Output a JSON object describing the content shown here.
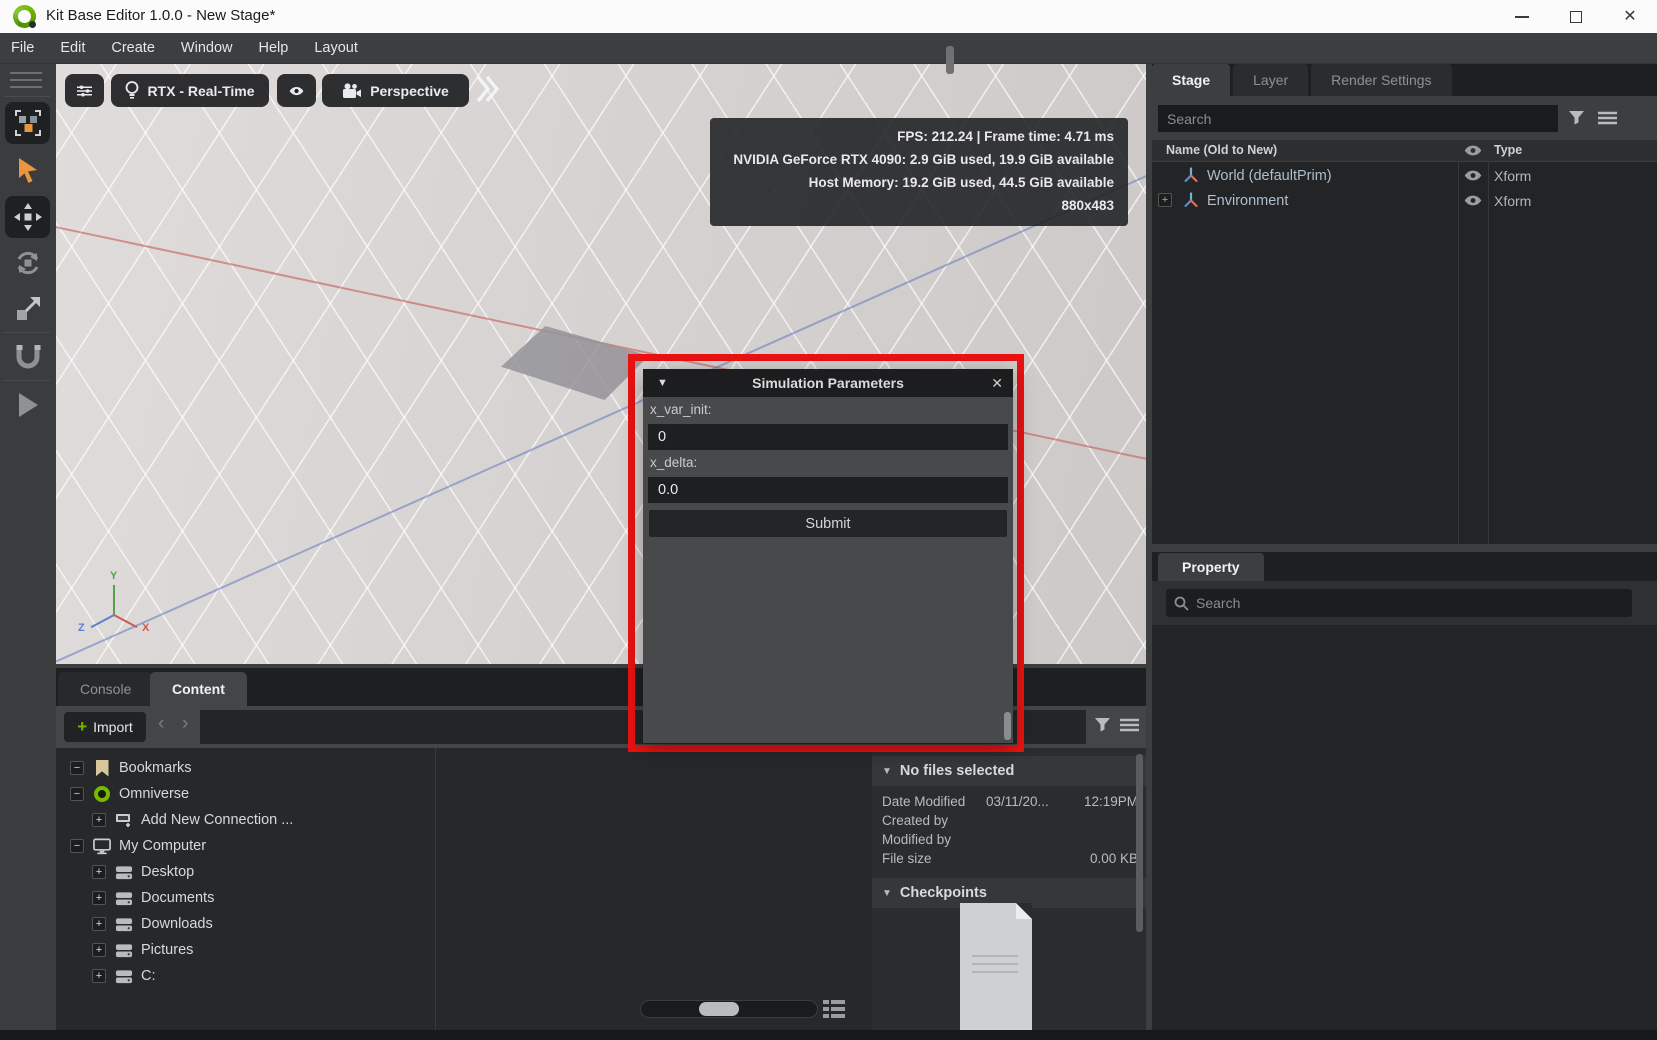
{
  "colors": {
    "highlight_red": "#ea1212",
    "omniverse_green": "#76b900",
    "select_orange": "#e8973f"
  },
  "window": {
    "title": "Kit Base Editor 1.0.0 - New Stage*"
  },
  "menu": {
    "items": [
      "File",
      "Edit",
      "Create",
      "Window",
      "Help",
      "Layout"
    ]
  },
  "viewport": {
    "renderer_button": "RTX - Real-Time",
    "camera_button": "Perspective",
    "stats": [
      "FPS: 212.24 | Frame time: 4.71 ms",
      "NVIDIA GeForce RTX 4090: 2.9 GiB used, 19.9 GiB available",
      "Host Memory: 19.2 GiB used, 44.5 GiB available",
      "880x483"
    ],
    "gizmo": {
      "x": "X",
      "y": "Y",
      "z": "Z"
    }
  },
  "dialog": {
    "title": "Simulation Parameters",
    "collapse_glyph": "▼",
    "close_glyph": "✕",
    "fields": [
      {
        "label": "x_var_init:",
        "value": "0"
      },
      {
        "label": "x_delta:",
        "value": "0.0"
      }
    ],
    "submit_label": "Submit"
  },
  "stage_panel": {
    "tabs": [
      {
        "label": "Stage"
      },
      {
        "label": "Layer"
      },
      {
        "label": "Render Settings"
      }
    ],
    "active_tab": "Stage",
    "search_placeholder": "Search",
    "columns": {
      "name": "Name (Old to New)",
      "type": "Type"
    },
    "rows": [
      {
        "name": "World (defaultPrim)",
        "type": "Xform",
        "expandable": false
      },
      {
        "name": "Environment",
        "type": "Xform",
        "expandable": true
      }
    ]
  },
  "property_panel": {
    "tab": "Property",
    "search_placeholder": "Search"
  },
  "content_panel": {
    "tabs": [
      {
        "label": "Console"
      },
      {
        "label": "Content"
      }
    ],
    "active_tab": "Content",
    "import_label": "Import",
    "nav": {
      "back_glyph": "‹",
      "forward_glyph": "›"
    },
    "tree": [
      {
        "label": "Bookmarks"
      },
      {
        "label": "Omniverse"
      },
      {
        "label": "Add New Connection ..."
      },
      {
        "label": "My Computer"
      },
      {
        "label": "Desktop"
      },
      {
        "label": "Documents"
      },
      {
        "label": "Downloads"
      },
      {
        "label": "Pictures"
      },
      {
        "label": "C:"
      }
    ],
    "info": {
      "header": "No files selected",
      "rows": [
        {
          "label": "Date Modified",
          "value": "03/11/20...",
          "value_right": "12:19PM"
        },
        {
          "label": "Created by",
          "value": "",
          "value_right": ""
        },
        {
          "label": "Modified by",
          "value": "",
          "value_right": ""
        },
        {
          "label": "File size",
          "value": "",
          "value_right": "0.00 KB"
        }
      ],
      "checkpoints_header": "Checkpoints"
    }
  }
}
